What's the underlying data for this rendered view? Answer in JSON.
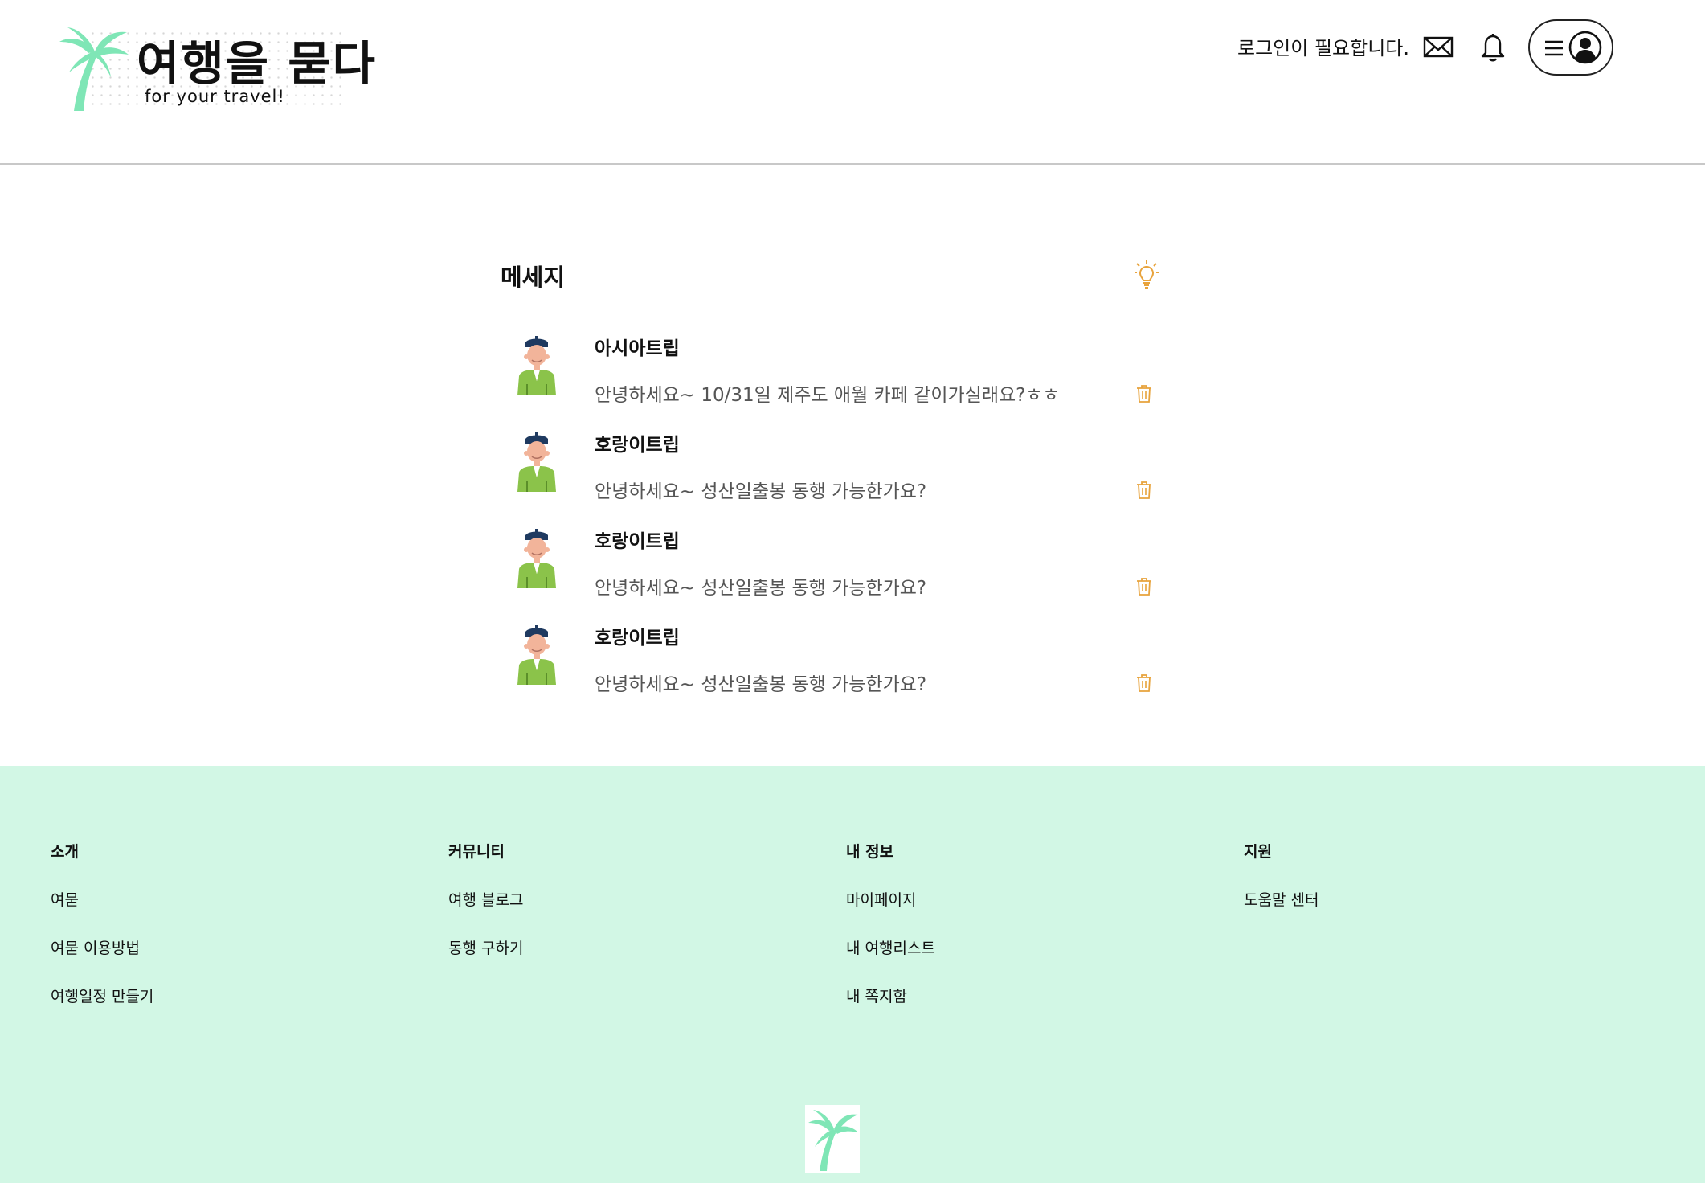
{
  "header": {
    "logo": {
      "title": "여행을 묻다",
      "subtitle": "for your travel!"
    },
    "login_text": "로그인이 필요합니다.",
    "icons": [
      "mail-icon",
      "bell-icon",
      "menu-icon",
      "user-icon"
    ]
  },
  "main": {
    "title": "메세지",
    "messages": [
      {
        "sender": "아시아트립",
        "preview": "안녕하세요~ 10/31일 제주도 애월 카페 같이가실래요?ㅎㅎ"
      },
      {
        "sender": "호랑이트립",
        "preview": "안녕하세요~ 성산일출봉 동행 가능한가요?"
      },
      {
        "sender": "호랑이트립",
        "preview": "안녕하세요~ 성산일출봉 동행 가능한가요?"
      },
      {
        "sender": "호랑이트립",
        "preview": "안녕하세요~ 성산일출봉 동행 가능한가요?"
      }
    ]
  },
  "footer": {
    "columns": [
      {
        "heading": "소개",
        "links": [
          "여묻",
          "여묻 이용방법",
          "여행일정 만들기"
        ]
      },
      {
        "heading": "커뮤니티",
        "links": [
          "여행 블로그",
          "동행 구하기"
        ]
      },
      {
        "heading": "내 정보",
        "links": [
          "마이페이지",
          "내 여행리스트",
          "내 쪽지함"
        ]
      },
      {
        "heading": "지원",
        "links": [
          "도움말 센터"
        ]
      }
    ]
  },
  "colors": {
    "accent_orange": "#e8a33c",
    "footer_bg": "#d2f7e5",
    "palm_green": "#7fe6b6",
    "divider": "#c8c8c8"
  }
}
